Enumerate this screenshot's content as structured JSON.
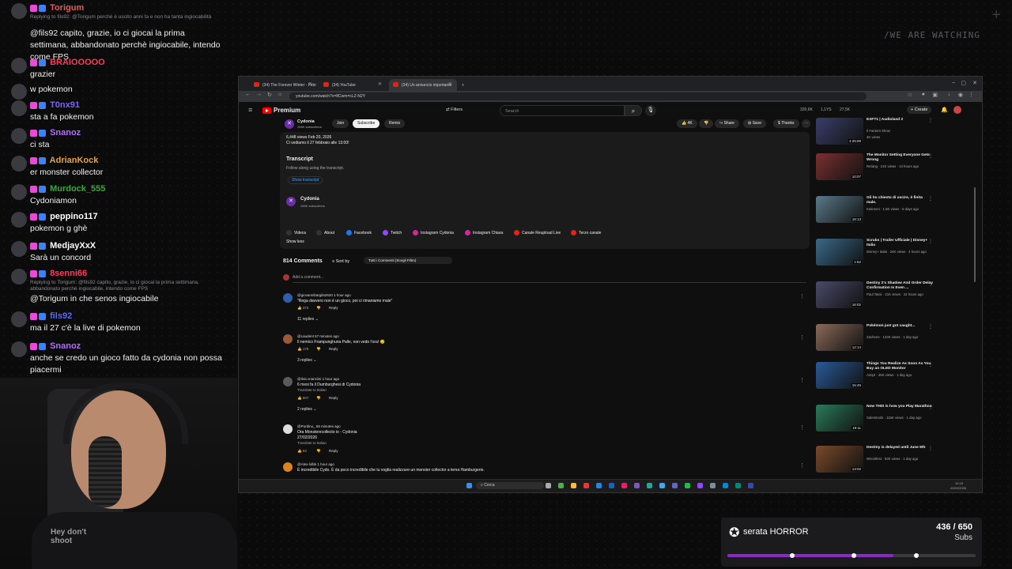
{
  "overlay": {
    "watermark": "/WE ARE WATCHING",
    "plus_icon": "+"
  },
  "chat": [
    {
      "user": "Torigum",
      "color": "#e05d5d",
      "reply": "Replying to fils92: @Torigum perchè è uscito anni fa e non ha tanta ingiocabilità",
      "text": "@fils92 capito, grazie, io ci giocai la prima settimana, abbandonato perchè ingiocabile, intendo come FPS"
    },
    {
      "user": "BRAIOOOOO",
      "color": "#ff3b5c",
      "reply": "",
      "text": "grazier"
    },
    {
      "user": "",
      "color": "#ffffff",
      "reply": "",
      "text": "w pokemon"
    },
    {
      "user": "T0nx91",
      "color": "#7b61ff",
      "reply": "",
      "text": "sta a fa pokemon"
    },
    {
      "user": "Snanoz",
      "color": "#b66bff",
      "reply": "",
      "text": "ci sta"
    },
    {
      "user": "AdrianKock",
      "color": "#e8a33d",
      "reply": "",
      "text": "er monster collector"
    },
    {
      "user": "Murdock_555",
      "color": "#3fa63f",
      "reply": "",
      "text": "Cydoniamon"
    },
    {
      "user": "peppino117",
      "color": "#ffffff",
      "reply": "",
      "text": "pokemon g ghè"
    },
    {
      "user": "MedjayXxX",
      "color": "#ffffff",
      "reply": "",
      "text": "Sarà un concord"
    },
    {
      "user": "8senni66",
      "color": "#ff3b5c",
      "reply": "Replying to Torigum: @fils92 capito, grazie, io ci giocai la prima settimana, abbandonato perchè ingiocabile, intendo come FPS",
      "text": "@Torigum in che senos ingiocabile"
    },
    {
      "user": "fils92",
      "color": "#5a6bff",
      "reply": "",
      "text": "ma il 27 c'è la live di pokemon"
    },
    {
      "user": "Snanoz",
      "color": "#b66bff",
      "reply": "",
      "text": "anche se credo un gioco fatto da cydonia non possa piacermi"
    }
  ],
  "webcam": {
    "shirt_text": "Hey don't shoot"
  },
  "browser": {
    "tabs": [
      "(34) The Forever Winter - Febr",
      "(34) YouTube",
      "(34) Un annuncio importante"
    ],
    "url": "youtube.com/watch?v=8Cwm=cLZ-N2Y",
    "premium": "Premium",
    "filters": "Filters",
    "search_placeholder": "Search",
    "create": "Create",
    "stats": [
      "320,6K",
      "1,1YS",
      "27,5K"
    ],
    "channel_name": "Cydonia",
    "channel_subs": "256K subscribers",
    "join": "Join",
    "subscribe": "Subscribe",
    "remix": "Remix",
    "likes": "4K",
    "share": "Share",
    "save": "Save",
    "thanks": "Thanks",
    "views_line": "6,448 views  Feb 20, 2026",
    "desc_line": "Ci vediamo il 27 febbraio alle 13:00!",
    "transcript_title": "Transcript",
    "transcript_sub": "Follow along using the transcript.",
    "show_transcript": "Show transcript",
    "desc_channel": "Cydonia",
    "desc_channel_subs": "256K subscribers",
    "links": [
      "Videos",
      "About",
      "Facebook",
      "Twitch",
      "Instagram Cydonia",
      "Instagram Chiara",
      "Canale Reupload Live",
      "Terzo canale"
    ],
    "show_less": "Show less",
    "comments_count": "814 Comments",
    "sort_by": "Sort by",
    "sort_value": "Tutti i Commenti (Scegli Filtro)",
    "add_comment": "Add a comment...",
    "comments": [
      {
        "user": "@giovannibargila2620  1 hour ago",
        "text": "\"Rega davvero non è un gioco, poi ci rimaniamo male\"",
        "likes": "372",
        "replies": "11 replies"
      },
      {
        "user": "@Laudent  57 minutes ago",
        "text": "Il nemico Frampunghuria Palle, non vedo l'ora! 😊",
        "likes": "175",
        "replies": "3 replies"
      },
      {
        "user": "@Ilvio.manciini  1 hour ago",
        "text": "6 mesi fa il Dumburghesi di Cydonia",
        "likes": "507",
        "replies": "2 replies",
        "translate": "Translate to Italian"
      },
      {
        "user": "@Purdino_  55 minutes ago",
        "text": "Ora Monsterecollecto io - Cydonia",
        "text2": "27/02/2026",
        "likes": "94",
        "replies": "",
        "translate": "Translate to Italian"
      },
      {
        "user": "@Alex-lolbk  1 hour ago",
        "text": "È incredibile Cydo. È da poco incredibile che tu voglia realizzare un monster collector a tema Hamburgerie.",
        "likes": "",
        "replies": ""
      }
    ],
    "reply_label": "Reply",
    "videos": [
      {
        "title": "EXFT1 | Audioland 2",
        "meta": "Il Fantom Show",
        "stat": "4K views",
        "dur": "4:25:00",
        "color": "#3a3f6a"
      },
      {
        "title": "The Monitor Setting Everyone Gets Wrong",
        "meta": "Retang · 21K views · 13 hours ago",
        "dur": "10:07",
        "color": "#7b3030"
      },
      {
        "title": "Gli ho chiesto di uscire, è finita male.",
        "meta": "Kekmoni · 1.5K views · 5 days ago",
        "dur": "18:13",
        "color": "#5a7a8a"
      },
      {
        "title": "Scrubs | Trailer Ufficiale | Disney+ Italia",
        "meta": "Disney+ Italia · 24K views · 4 hours ago",
        "dur": "1:52",
        "color": "#3a6a8a"
      },
      {
        "title": "Destiny 2's Shadow And Order Delay Confirmation Is Even ...",
        "meta": "Paul Tassi · 21K views · 22 hours ago",
        "dur": "16:02",
        "color": "#4a4a6a"
      },
      {
        "title": "Pokémon just got caught...",
        "meta": "Zachene · 134K views · 1 day ago",
        "dur": "12:14",
        "color": "#8a6a5a"
      },
      {
        "title": "Things You Realize As Soon As You Buy an OLED Monitor",
        "meta": "Aimpt · 45K views · 1 day ago",
        "dur": "15:45",
        "color": "#2a5a9a"
      },
      {
        "title": "Now THIS is how you Play Marathon",
        "meta": "Salemtools · 115K views · 1 day ago",
        "dur": "19:11",
        "color": "#2a7a5a"
      },
      {
        "title": "Destiny is delayed until June 9th",
        "meta": "Wreckfest · 63K views · 1 day ago",
        "dur": "13:02",
        "color": "#7a4a2a"
      }
    ],
    "taskbar_search": "Cerca",
    "taskbar_time": "14:18",
    "taskbar_date": "20/02/2026"
  },
  "goal": {
    "title": "serata HORROR",
    "count": "436 / 650",
    "unit": "Subs",
    "progress_fraction": 0.67
  }
}
